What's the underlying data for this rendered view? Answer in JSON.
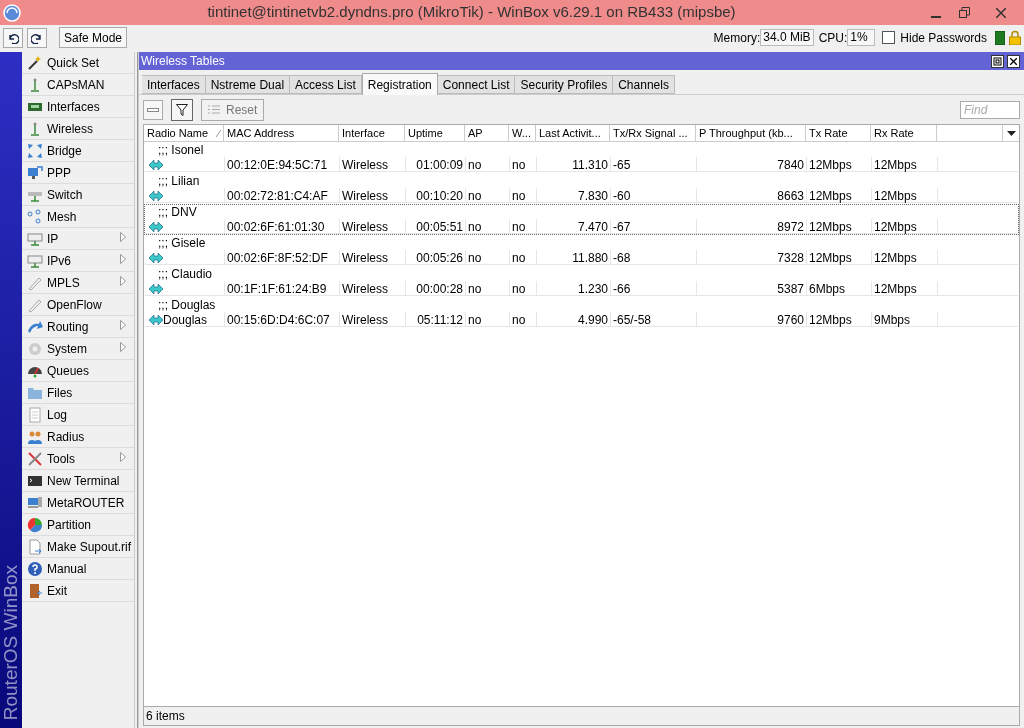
{
  "title_bar": {
    "title": "tintinet@tintinetvb2.dyndns.pro (MikroTik) - WinBox v6.29.1 on RB433 (mipsbe)"
  },
  "toolbar": {
    "safe_mode": "Safe Mode",
    "memory_label": "Memory:",
    "memory_value": "34.0 MiB",
    "cpu_label": "CPU:",
    "cpu_value": "1%",
    "hide_passwords": {
      "label": "Hide Passwords",
      "checked": false
    }
  },
  "brand": "RouterOS WinBox",
  "sidebar": {
    "items": [
      {
        "label": "Quick Set",
        "submenu": false
      },
      {
        "label": "CAPsMAN",
        "submenu": false
      },
      {
        "label": "Interfaces",
        "submenu": false
      },
      {
        "label": "Wireless",
        "submenu": false
      },
      {
        "label": "Bridge",
        "submenu": false
      },
      {
        "label": "PPP",
        "submenu": false
      },
      {
        "label": "Switch",
        "submenu": false
      },
      {
        "label": "Mesh",
        "submenu": false
      },
      {
        "label": "IP",
        "submenu": true
      },
      {
        "label": "IPv6",
        "submenu": true
      },
      {
        "label": "MPLS",
        "submenu": true
      },
      {
        "label": "OpenFlow",
        "submenu": false
      },
      {
        "label": "Routing",
        "submenu": true
      },
      {
        "label": "System",
        "submenu": true
      },
      {
        "label": "Queues",
        "submenu": false
      },
      {
        "label": "Files",
        "submenu": false
      },
      {
        "label": "Log",
        "submenu": false
      },
      {
        "label": "Radius",
        "submenu": false
      },
      {
        "label": "Tools",
        "submenu": true
      },
      {
        "label": "New Terminal",
        "submenu": false
      },
      {
        "label": "MetaROUTER",
        "submenu": false
      },
      {
        "label": "Partition",
        "submenu": false
      },
      {
        "label": "Make Supout.rif",
        "submenu": false
      },
      {
        "label": "Manual",
        "submenu": false
      },
      {
        "label": "Exit",
        "submenu": false
      }
    ]
  },
  "window": {
    "title": "Wireless Tables",
    "tabs": [
      {
        "label": "Interfaces",
        "selected": false
      },
      {
        "label": "Nstreme Dual",
        "selected": false
      },
      {
        "label": "Access List",
        "selected": false
      },
      {
        "label": "Registration",
        "selected": true
      },
      {
        "label": "Connect List",
        "selected": false
      },
      {
        "label": "Security Profiles",
        "selected": false
      },
      {
        "label": "Channels",
        "selected": false
      }
    ],
    "reset_button": "Reset",
    "find": {
      "placeholder": "Find"
    },
    "table": {
      "columns": [
        {
          "label": "Radio Name",
          "sorted": true
        },
        {
          "label": "MAC Address",
          "sorted": false
        },
        {
          "label": "Interface",
          "sorted": false
        },
        {
          "label": "Uptime",
          "sorted": false
        },
        {
          "label": "AP",
          "sorted": false
        },
        {
          "label": "W...",
          "sorted": false
        },
        {
          "label": "Last Activit...",
          "sorted": false
        },
        {
          "label": "Tx/Rx Signal ...",
          "sorted": false
        },
        {
          "label": "P Throughput (kb...",
          "sorted": false
        },
        {
          "label": "Tx Rate",
          "sorted": false
        },
        {
          "label": "Rx Rate",
          "sorted": false
        }
      ],
      "rows": [
        {
          "comment": ";;; Isonel",
          "selected": false,
          "cells": {
            "mac": "00:12:0E:94:5C:71",
            "interface": "Wireless",
            "uptime": "01:00:09",
            "ap": "no",
            "w": "no",
            "last_activity": "11.310",
            "signal": "-65",
            "throughput": "7840",
            "tx_rate": "12Mbps",
            "rx_rate": "12Mbps"
          }
        },
        {
          "comment": ";;; Lilian",
          "selected": false,
          "cells": {
            "mac": "00:02:72:81:C4:AF",
            "interface": "Wireless",
            "uptime": "00:10:20",
            "ap": "no",
            "w": "no",
            "last_activity": "7.830",
            "signal": "-60",
            "throughput": "8663",
            "tx_rate": "12Mbps",
            "rx_rate": "12Mbps"
          }
        },
        {
          "comment": ";;; DNV",
          "selected": true,
          "cells": {
            "mac": "00:02:6F:61:01:30",
            "interface": "Wireless",
            "uptime": "00:05:51",
            "ap": "no",
            "w": "no",
            "last_activity": "7.470",
            "signal": "-67",
            "throughput": "8972",
            "tx_rate": "12Mbps",
            "rx_rate": "12Mbps"
          }
        },
        {
          "comment": ";;; Gisele",
          "selected": false,
          "cells": {
            "mac": "00:02:6F:8F:52:DF",
            "interface": "Wireless",
            "uptime": "00:05:26",
            "ap": "no",
            "w": "no",
            "last_activity": "11.880",
            "signal": "-68",
            "throughput": "7328",
            "tx_rate": "12Mbps",
            "rx_rate": "12Mbps"
          }
        },
        {
          "comment": ";;; Claudio",
          "selected": false,
          "cells": {
            "mac": "00:1F:1F:61:24:B9",
            "interface": "Wireless",
            "uptime": "00:00:28",
            "ap": "no",
            "w": "no",
            "last_activity": "1.230",
            "signal": "-66",
            "throughput": "5387",
            "tx_rate": "6Mbps",
            "rx_rate": "12Mbps"
          }
        },
        {
          "comment": ";;; Douglas",
          "selected": false,
          "cells": {
            "radio_name": "Douglas",
            "mac": "00:15:6D:D4:6C:07",
            "interface": "Wireless",
            "uptime": "05:11:12",
            "ap": "no",
            "w": "no",
            "last_activity": "4.990",
            "signal": "-65/-58",
            "throughput": "9760",
            "tx_rate": "12Mbps",
            "rx_rate": "9Mbps"
          }
        }
      ]
    },
    "status": "6 items"
  }
}
